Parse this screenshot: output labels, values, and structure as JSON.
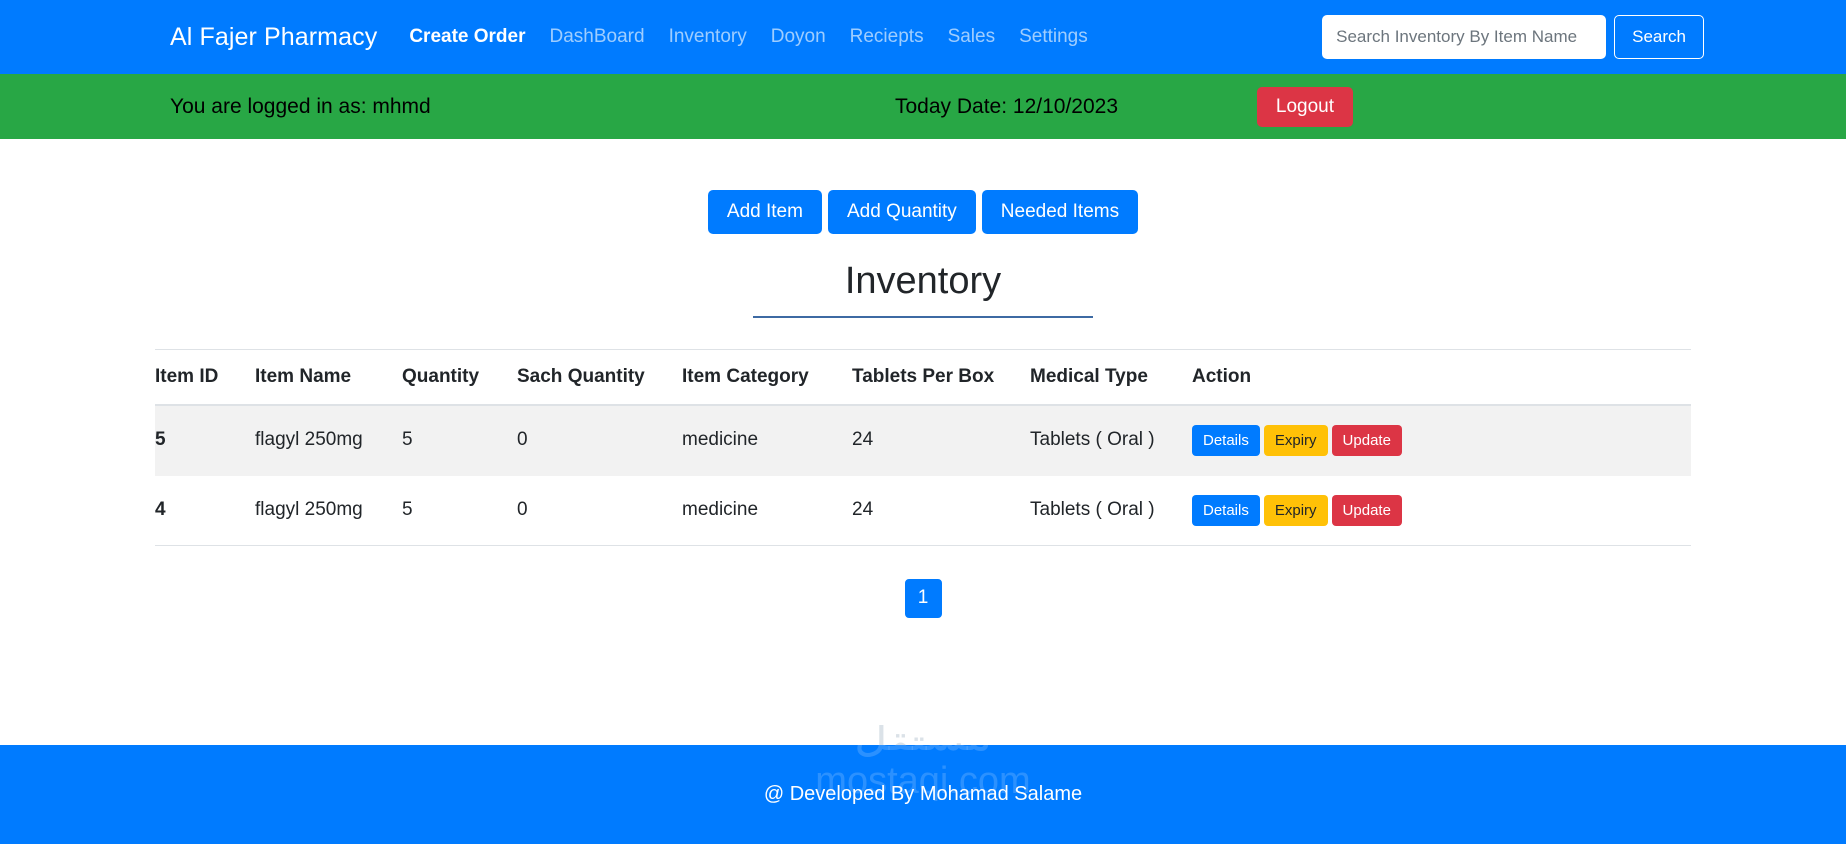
{
  "navbar": {
    "brand": "Al Fajer Pharmacy",
    "links": [
      {
        "label": "Create Order",
        "active": true
      },
      {
        "label": "DashBoard",
        "active": false
      },
      {
        "label": "Inventory",
        "active": false
      },
      {
        "label": "Doyon",
        "active": false
      },
      {
        "label": "Reciepts",
        "active": false
      },
      {
        "label": "Sales",
        "active": false
      },
      {
        "label": "Settings",
        "active": false
      }
    ],
    "search": {
      "placeholder": "Search Inventory By Item Name",
      "value": "",
      "button_label": "Search"
    }
  },
  "statusbar": {
    "user_text": "You are logged in as: mhmd",
    "date_text": "Today Date: 12/10/2023",
    "logout_label": "Logout"
  },
  "toolbar": {
    "add_item_label": "Add Item",
    "add_quantity_label": "Add Quantity",
    "needed_items_label": "Needed Items"
  },
  "page": {
    "title": "Inventory"
  },
  "table": {
    "columns": [
      "Item ID",
      "Item Name",
      "Quantity",
      "Sach Quantity",
      "Item Category",
      "Tablets Per Box",
      "Medical Type",
      "Action"
    ],
    "rows": [
      {
        "item_id": "5",
        "item_name": "flagyl 250mg",
        "quantity": "5",
        "sach_quantity": "0",
        "item_category": "medicine",
        "tablets_per_box": "24",
        "medical_type": "Tablets ( Oral )",
        "actions": {
          "details": "Details",
          "expiry": "Expiry",
          "update": "Update"
        }
      },
      {
        "item_id": "4",
        "item_name": "flagyl 250mg",
        "quantity": "5",
        "sach_quantity": "0",
        "item_category": "medicine",
        "tablets_per_box": "24",
        "medical_type": "Tablets ( Oral )",
        "actions": {
          "details": "Details",
          "expiry": "Expiry",
          "update": "Update"
        }
      }
    ]
  },
  "pagination": {
    "current_page": "1"
  },
  "watermark": {
    "arabic": "مستقل",
    "latin": "mostaqi.com"
  },
  "footer": {
    "text": "@ Developed By Mohamad Salame"
  },
  "colors": {
    "primary": "#007bff",
    "success": "#28a745",
    "danger": "#dc3545",
    "warning": "#ffc107",
    "title_underline": "#3d6aa3",
    "row_stripe": "#f2f2f2"
  }
}
